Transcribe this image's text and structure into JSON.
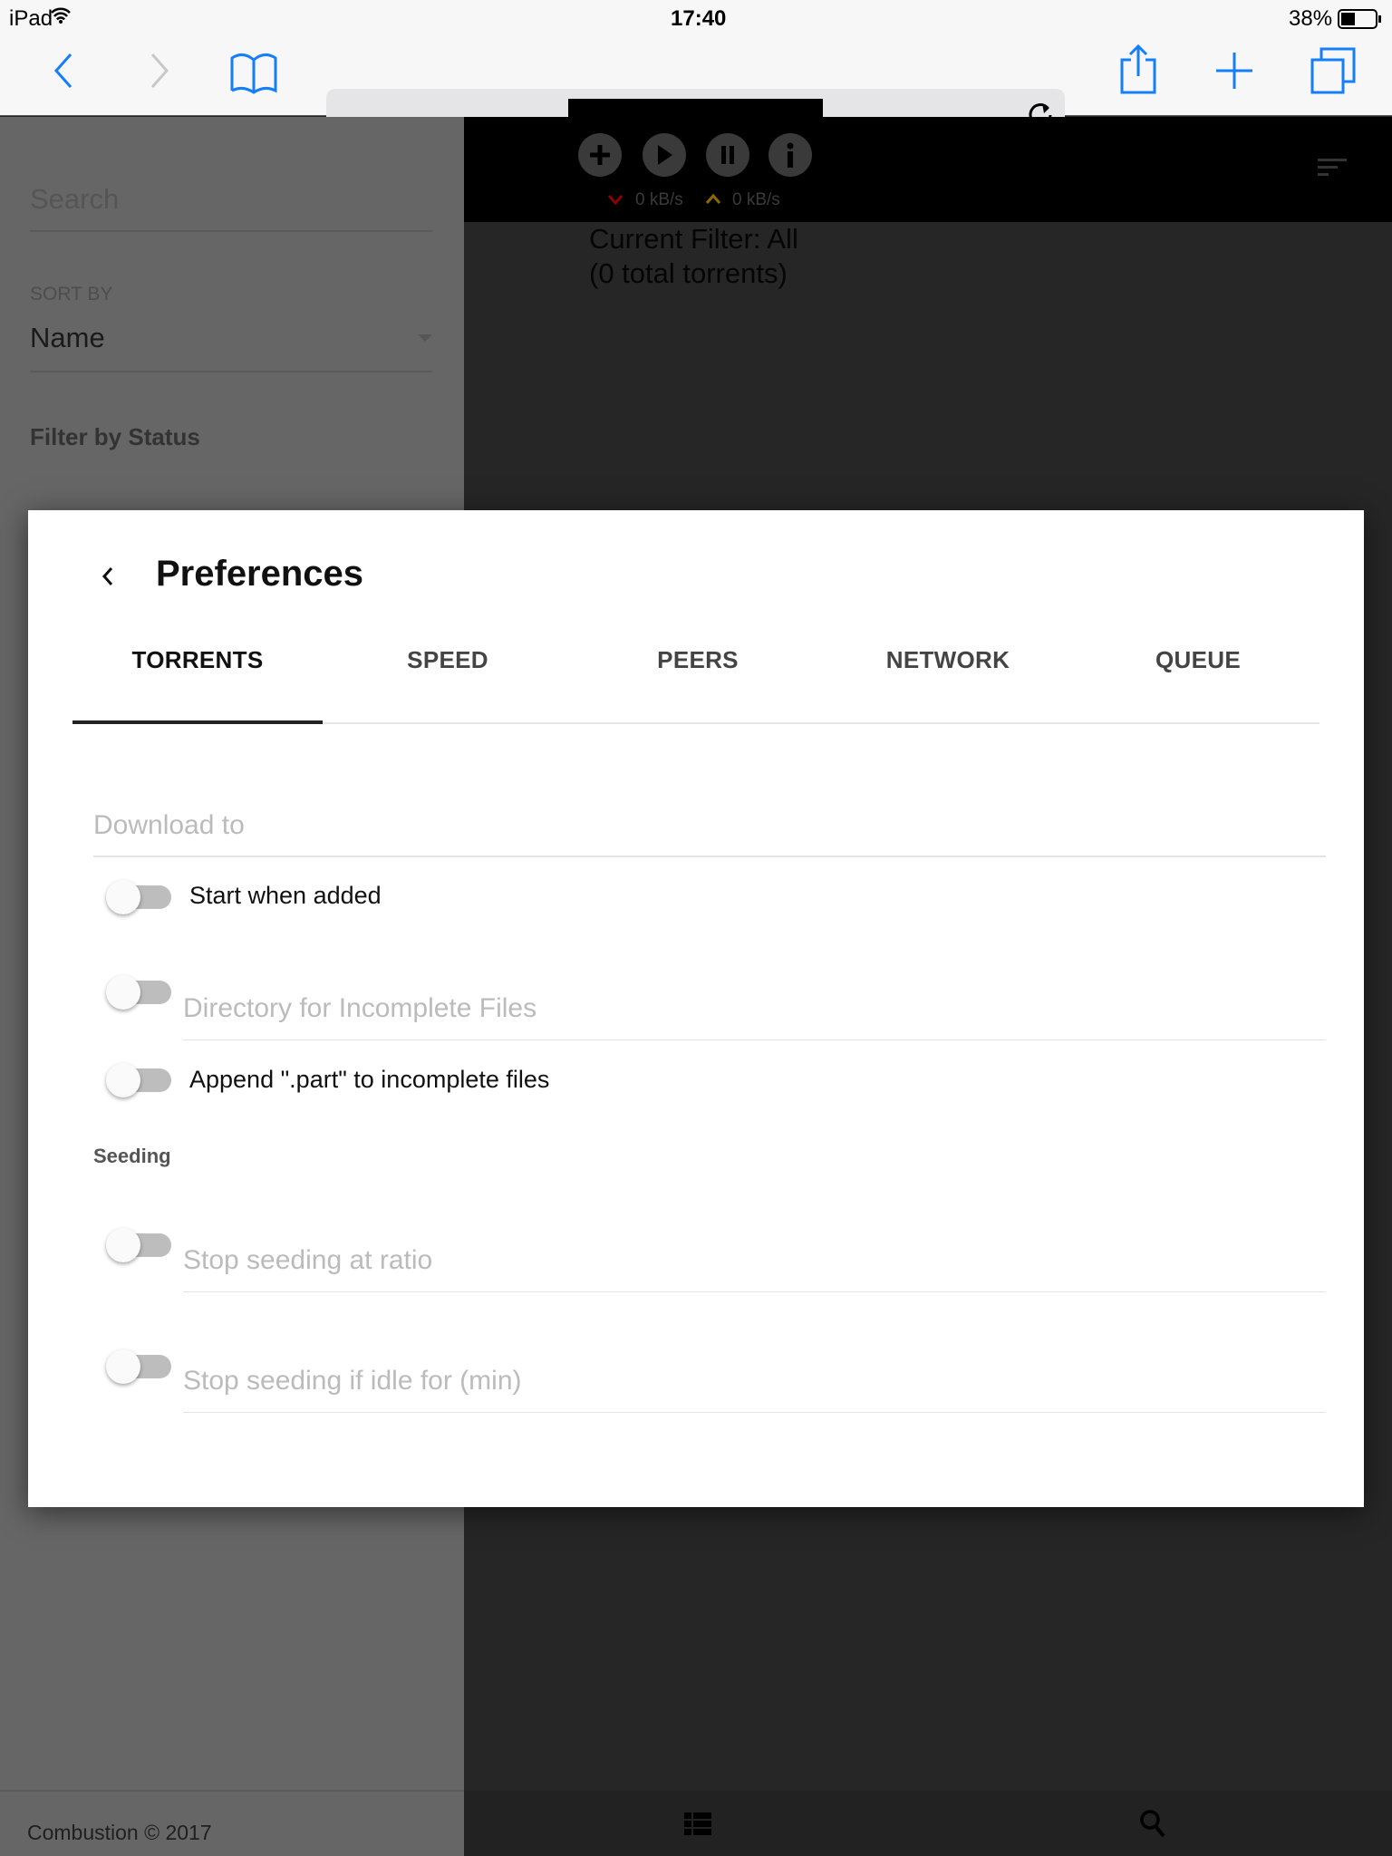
{
  "status_bar": {
    "device": "iPad",
    "time": "17:40",
    "battery": "38%",
    "battery_level": 0.38
  },
  "browser": {
    "icons": [
      "back-icon",
      "forward-icon",
      "bookmarks-icon",
      "reload-icon",
      "share-icon",
      "new-tab-icon",
      "tabs-icon"
    ]
  },
  "sidebar": {
    "search_placeholder": "Search",
    "sort_by_label": "SORT BY",
    "sort_value": "Name",
    "filter_heading": "Filter by Status",
    "footer": "Combustion © 2017"
  },
  "header": {
    "download_speed": "0 kB/s",
    "upload_speed": "0 kB/s",
    "filter_line1": "Current Filter: All",
    "filter_line2": "(0 total torrents)"
  },
  "modal": {
    "title": "Preferences",
    "tabs": [
      {
        "label": "TORRENTS",
        "active": true
      },
      {
        "label": "SPEED"
      },
      {
        "label": "PEERS"
      },
      {
        "label": "NETWORK"
      },
      {
        "label": "QUEUE"
      }
    ],
    "download_to_placeholder": "Download to",
    "start_when_added": {
      "label": "Start when added",
      "on": false
    },
    "incomplete_dir": {
      "placeholder": "Directory for Incomplete Files",
      "on": false
    },
    "append_part": {
      "label": "Append \".part\" to incomplete files",
      "on": false
    },
    "seeding_heading": "Seeding",
    "stop_ratio": {
      "placeholder": "Stop seeding at ratio",
      "on": false
    },
    "stop_idle": {
      "placeholder": "Stop seeding if idle for (min)",
      "on": false
    }
  },
  "colors": {
    "accent": "#147efb",
    "download_arrow": "#8b0000",
    "upload_arrow": "#8b6a00"
  }
}
